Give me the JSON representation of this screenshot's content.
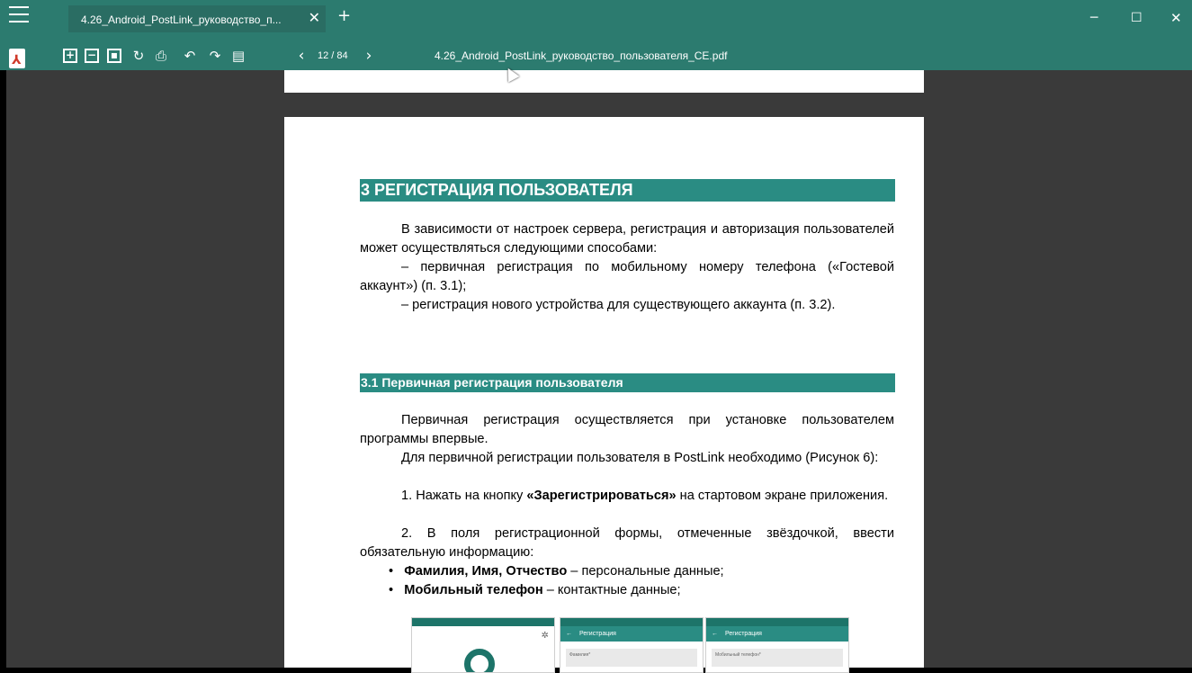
{
  "window": {
    "tab_title": "4.26_Android_PostLink_руководство_п...",
    "tab_close": "✕",
    "new_tab": "+",
    "min": "─",
    "max": "☐",
    "close": "✕"
  },
  "toolbar": {
    "page_indicator": "12 / 84",
    "document_title": "4.26_Android_PostLink_руководство_пользователя_CE.pdf",
    "icons": [
      "pdf-icon",
      "zoom-in-icon",
      "zoom-out-icon",
      "fit-page-icon",
      "rotate-icon",
      "print-icon",
      "rotate-left-icon",
      "rotate-right-icon",
      "save-icon",
      "prev-page-icon",
      "next-page-icon"
    ]
  },
  "document": {
    "heading1": "3 РЕГИСТРАЦИЯ ПОЛЬЗОВАТЕЛЯ",
    "p1": "В зависимости от настроек сервера, регистрация и авторизация пользователей может осуществляться следующими способами:",
    "p2": "–       первичная регистрация по мобильному номеру телефона («Гостевой аккаунт») (п. 3.1);",
    "p3": "–       регистрация нового устройства для существующего аккаунта (п. 3.2).",
    "heading2": "3.1    Первичная регистрация пользователя",
    "p4": "Первичная регистрация осуществляется при установке пользователем программы впервые.",
    "p5": "Для первичной регистрации пользователя в PostLink необходимо (Рисунок 6):",
    "p6_start": "1. Нажать на кнопку ",
    "p6_bold": "«Зарегистрироваться»",
    "p6_end": " на стартовом экране приложения.",
    "p7": "2. В поля регистрационной формы, отмеченные звёздочкой, ввести обязательную информацию:",
    "b1_bold": "Фамилия, Имя, Отчество",
    "b1_rest": " – персональные данные;",
    "b2_bold": "Мобильный телефон",
    "b2_rest": " – контактные данные;"
  },
  "phones": {
    "p2_title": "Регистрация",
    "p2_field": "Фамилия*",
    "p3_title": "Регистрация",
    "p3_field": "Мобильный телефон*"
  }
}
